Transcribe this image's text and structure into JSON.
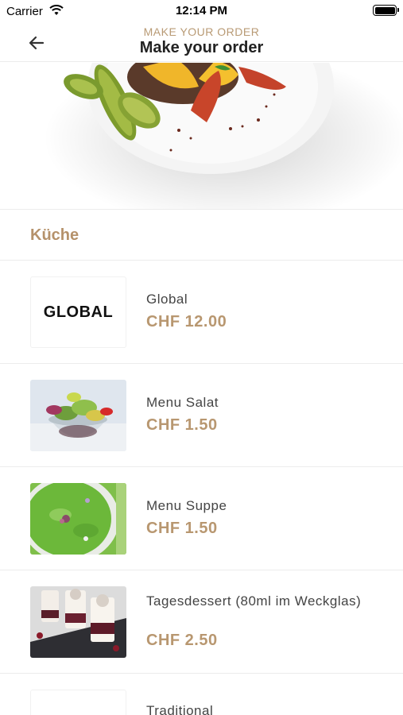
{
  "status_bar": {
    "carrier": "Carrier",
    "time": "12:14 PM"
  },
  "nav": {
    "subtitle": "MAKE YOUR ORDER",
    "title": "Make your order"
  },
  "section": {
    "title": "Küche"
  },
  "items": [
    {
      "name": "Global",
      "price": "CHF 12.00",
      "thumb_text": "GLOBAL"
    },
    {
      "name": "Menu Salat",
      "price": "CHF 1.50"
    },
    {
      "name": "Menu Suppe",
      "price": "CHF 1.50"
    },
    {
      "name": "Tagesdessert (80ml im Weckglas)",
      "price": "CHF 2.50"
    },
    {
      "name": "Traditional"
    }
  ],
  "colors": {
    "accent": "#b89770",
    "section": "#b5916a",
    "subtitle": "#b89a74"
  }
}
